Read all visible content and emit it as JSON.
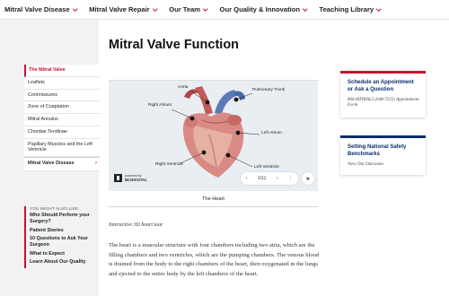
{
  "nav": {
    "items": [
      {
        "label": "Mitral Valve Disease"
      },
      {
        "label": "Mitral Valve Repair"
      },
      {
        "label": "Our Team"
      },
      {
        "label": "Our Quality & Innovation"
      },
      {
        "label": "Teaching Library"
      }
    ]
  },
  "page": {
    "title": "Mitral Valve Function"
  },
  "sidebar": {
    "items": [
      {
        "label": "The Mitral Valve"
      },
      {
        "label": "Leaflets"
      },
      {
        "label": "Commissures"
      },
      {
        "label": "Zone of Coaptation"
      },
      {
        "label": "Mitral Annulus"
      },
      {
        "label": "Chordae Tendinae"
      },
      {
        "label": "Papillary Muscles and the Left Ventricle"
      },
      {
        "label": "Mitral Valve Disease"
      }
    ],
    "parent_arrow": "›"
  },
  "also": {
    "heading": "YOU MIGHT ALSO LIKE",
    "links": [
      {
        "label": "Who Should Perform your Surgery?"
      },
      {
        "label": "Patient Stories"
      },
      {
        "label": "10 Questions to Ask Your Surgeon"
      },
      {
        "label": "What to Expect"
      },
      {
        "label": "Learn About Our Quality"
      }
    ]
  },
  "viewer": {
    "labels": {
      "aorta": "Aorta",
      "pulmonary_trunk": "Pulmonary Trunk",
      "right_atrium": "Right Atrium",
      "left_atrium": "Left Atrium",
      "right_ventricle": "Right Ventricle",
      "left_ventricle": "Left Ventricle"
    },
    "powered_by": "powered by",
    "brand": "BIODIGITAL",
    "counter": "1/11",
    "caption": "The Heart"
  },
  "content": {
    "italic_caption": "Interactive 3D heart tour",
    "body": "The heart is a muscular structure with four chambers including two atria, which are the filling chambers and two ventricles, which are the pumping chambers. The venous blood is drained from the body to the right chambers of the heart, then oxygenated in the lungs and ejected to the entire body by the left chambers of the heart."
  },
  "cards": {
    "appointment": {
      "title": "Schedule an Appointment or Ask a Question",
      "sub": "866-MITRAL5 (648-7255) Appointment Form"
    },
    "benchmarks": {
      "title": "Setting National Safety Benchmarks",
      "sub": "View Our Outcomes"
    }
  },
  "colors": {
    "accent_red": "#c8102e",
    "navy": "#0b2d6b"
  }
}
